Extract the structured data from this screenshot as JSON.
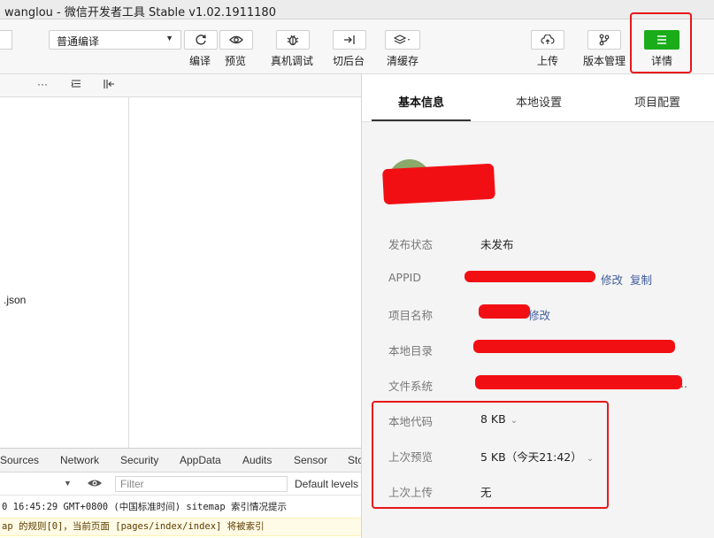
{
  "window": {
    "title": "wanglou - 微信开发者工具 Stable v1.02.1911180"
  },
  "toolbar": {
    "compile_mode": "普通编译",
    "buttons": {
      "compile": "编译",
      "preview": "预览",
      "remote_debug": "真机调试",
      "background": "切后台",
      "clear_cache": "清缓存",
      "upload": "上传",
      "version_mgmt": "版本管理",
      "details": "详情"
    }
  },
  "left_panel": {
    "more": "···",
    "file_json": ".json"
  },
  "devtools": {
    "tabs": [
      "Sources",
      "Network",
      "Security",
      "AppData",
      "Audits",
      "Sensor",
      "Sto"
    ],
    "filter_placeholder": "Filter",
    "levels": "Default levels",
    "log_line_1": "0 16:45:29 GMT+0800 (中国标准时间) sitemap 索引情况提示",
    "log_line_2": "ap 的规则[0]，当前页面 [pages/index/index] 将被索引"
  },
  "details": {
    "tabs": {
      "basic": "基本信息",
      "local": "本地设置",
      "project": "项目配置"
    },
    "rows": {
      "publish_status": {
        "label": "发布状态",
        "value": "未发布"
      },
      "appid": {
        "label": "APPID",
        "modify": "修改",
        "copy": "复制"
      },
      "project_name": {
        "label": "项目名称",
        "modify": "修改"
      },
      "local_dir": {
        "label": "本地目录"
      },
      "filesystem": {
        "label": "文件系统",
        "trailing": ".."
      },
      "local_code": {
        "label": "本地代码",
        "value": "8 KB"
      },
      "last_preview": {
        "label": "上次预览",
        "value": "5 KB（今天21:42）"
      },
      "last_upload": {
        "label": "上次上传",
        "value": "无"
      }
    }
  },
  "colors": {
    "accent_green": "#1aad19",
    "highlight_red": "#e8171a",
    "link_blue": "#3f5d9b"
  }
}
